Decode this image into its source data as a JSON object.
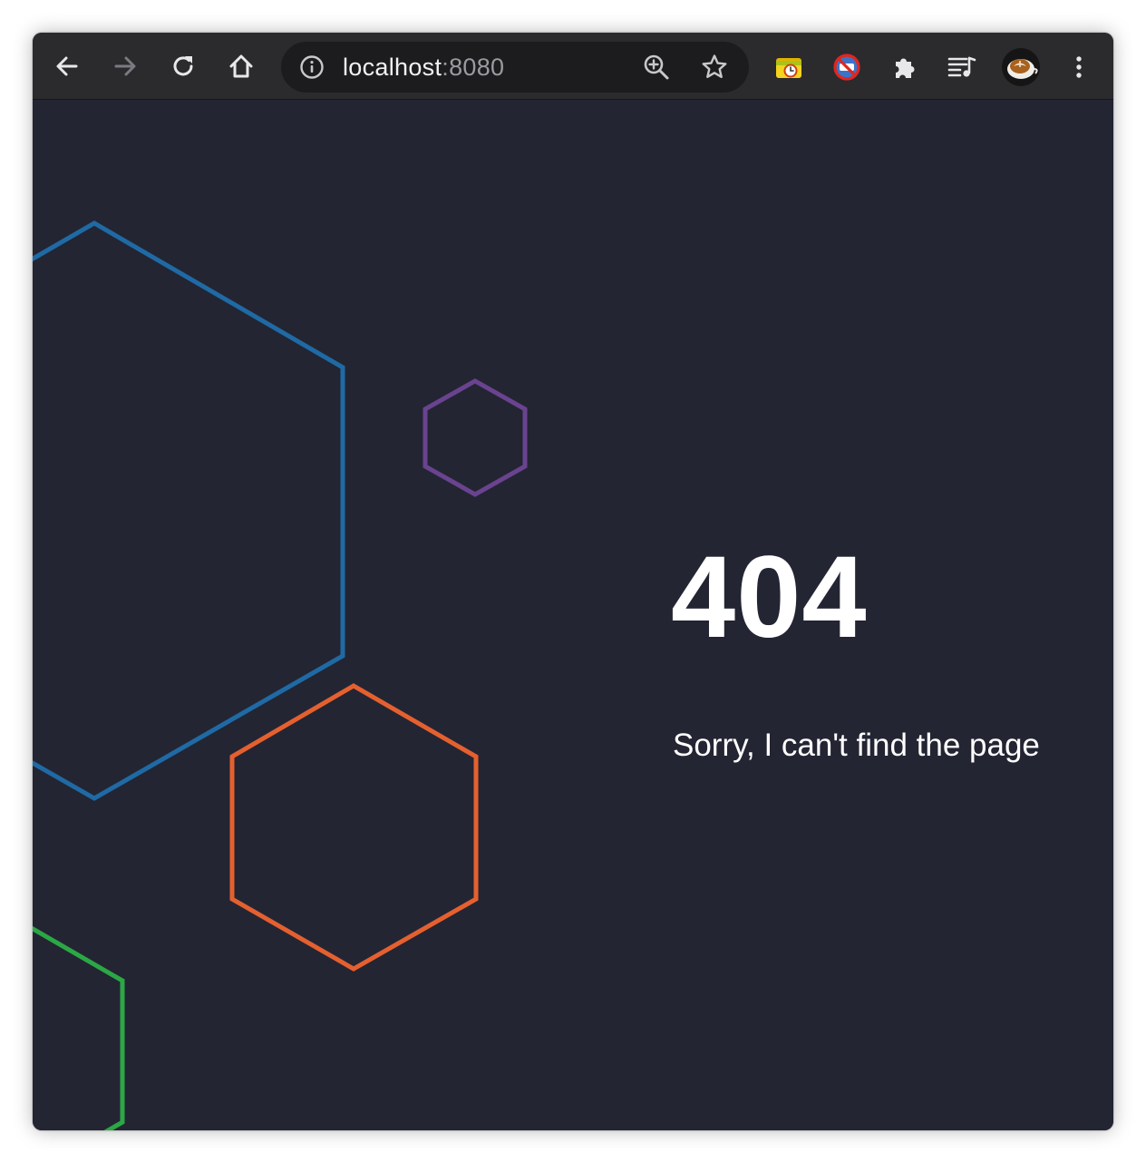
{
  "browser": {
    "url_host": "localhost",
    "url_port": ":8080",
    "nav": {
      "back_icon": "arrow-left-icon",
      "forward_icon": "arrow-right-icon",
      "reload_icon": "reload-icon",
      "home_icon": "home-icon"
    },
    "omnibox_icons": [
      "info-icon",
      "zoom-in-icon",
      "bookmark-star-icon"
    ],
    "extensions": [
      "folder-clock-icon",
      "no-entry-icon",
      "puzzle-icon",
      "media-queue-icon",
      "profile-avatar-icon",
      "kebab-menu-icon"
    ],
    "colors": {
      "toolbar": "#2b2b2e",
      "omnibox": "#1c1c1e",
      "icon": "#e8e8ea",
      "icon_disabled": "#7a7a80"
    }
  },
  "page": {
    "error_code": "404",
    "message": "Sorry, I can't find the page",
    "colors": {
      "background": "#232533",
      "text": "#ffffff",
      "hex_blue": "#1f6aa5",
      "hex_purple": "#6a4390",
      "hex_orange": "#e5602f",
      "hex_green": "#2ba844"
    }
  }
}
